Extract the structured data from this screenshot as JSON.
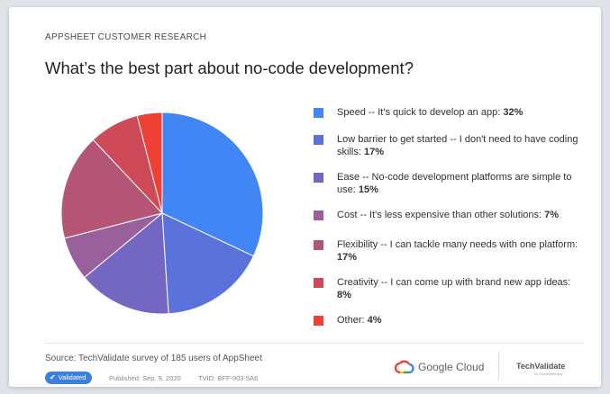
{
  "header": {
    "eyebrow": "APPSHEET CUSTOMER RESEARCH",
    "title": "What’s the best part about no-code development?"
  },
  "chart_data": {
    "type": "pie",
    "title": "What’s the best part about no-code development?",
    "slices": [
      {
        "label": "Speed -- It's quick to develop an app:",
        "value": 32,
        "display": "32%",
        "color": "#4285f4"
      },
      {
        "label": "Low barrier to get started -- I don't need to have coding skills:",
        "value": 17,
        "display": "17%",
        "color": "#5a72d9"
      },
      {
        "label": "Ease -- No-code development platforms are simple to use:",
        "value": 15,
        "display": "15%",
        "color": "#7467c2"
      },
      {
        "label": "Cost -- It's less expensive than other solutions:",
        "value": 7,
        "display": "7%",
        "color": "#99609c"
      },
      {
        "label": "Flexibility -- I can tackle many needs with one platform:",
        "value": 17,
        "display": "17%",
        "color": "#b55576"
      },
      {
        "label": "Creativity -- I can come up with brand new app ideas:",
        "value": 8,
        "display": "8%",
        "color": "#cf4a59"
      },
      {
        "label": "Other:",
        "value": 4,
        "display": "4%",
        "color": "#ee4035"
      }
    ],
    "legend_position": "right"
  },
  "footer": {
    "source": "Source: TechValidate survey of 185 users of AppSheet",
    "badge_label": "Validated",
    "published": "Published: Sep. 9, 2020",
    "tvid": "TVID: BFF-903-5A6",
    "google_cloud": "Google Cloud",
    "techvalidate": "TechValidate",
    "techvalidate_sub": "by SurveyMonkey"
  }
}
